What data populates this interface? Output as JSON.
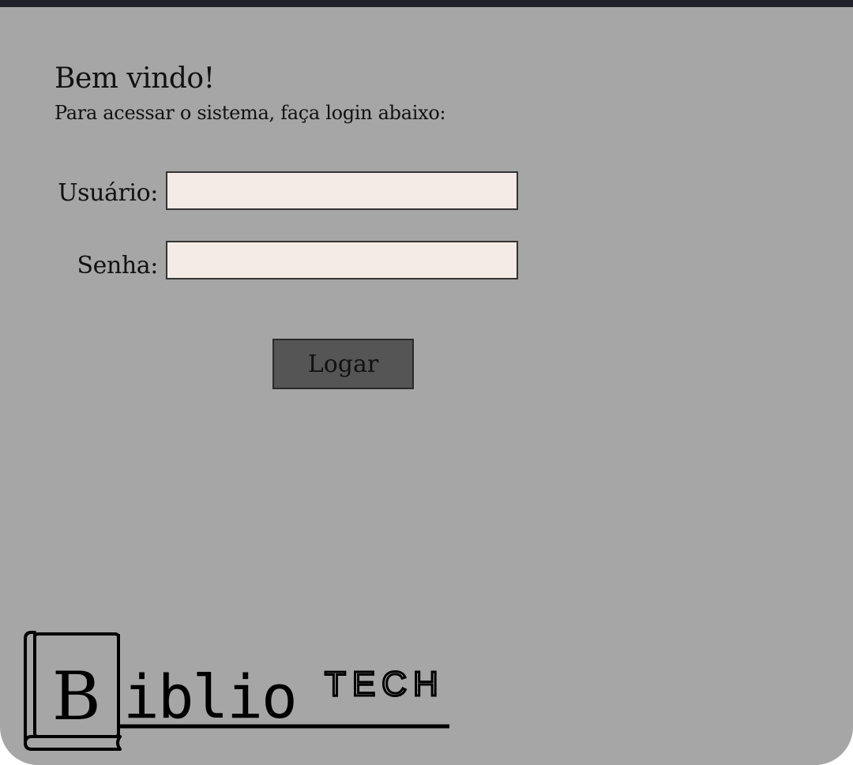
{
  "header": {
    "greeting": "Bem vindo!",
    "instructions": "Para acessar o sistema, faça login abaixo:"
  },
  "login_form": {
    "username_label": "Usuário:",
    "username_value": "",
    "password_label": "Senha:",
    "password_value": "",
    "submit_label": "Logar"
  },
  "logo": {
    "brand_text": "BiblioTECH",
    "icon": "book-icon"
  },
  "colors": {
    "background": "#a6a6a6",
    "top_bar": "#22222a",
    "input_background": "#f5ebe6",
    "button_background": "#555555"
  }
}
